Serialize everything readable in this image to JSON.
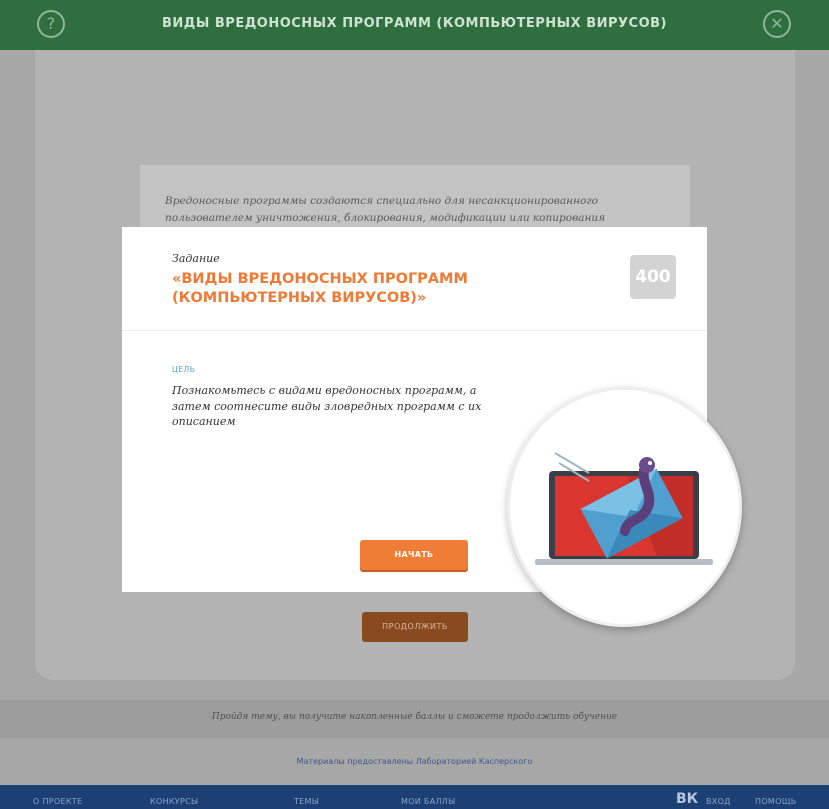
{
  "header": {
    "title": "ВИДЫ ВРЕДОНОСНЫХ ПРОГРАММ (КОМПЬЮТЕРНЫХ ВИРУСОВ)",
    "help_icon": "question-circle-icon",
    "close_icon": "close-circle-icon",
    "help_glyph": "?",
    "close_glyph": "✕"
  },
  "background": {
    "text": "Вредоносные программы создаются специально для несанкционированного пользователем уничтожения, блокирования, модификации или копирования",
    "continue_button": "ПРОДОЛЖИТЬ",
    "info_text": "Пройдя тему, вы получите накопленные баллы и сможете продолжить обучение",
    "link_text": "Материалы предоставлены Лабораторией Касперского"
  },
  "modal": {
    "label": "Задание",
    "title": "«ВИДЫ ВРЕДОНОСНЫХ ПРОГРАММ (КОМПЬЮТЕРНЫХ ВИРУСОВ)»",
    "score": "400",
    "goal_label": "ЦЕЛЬ",
    "goal_text": "Познакомьтесь с видами вредоносных программ, а затем соотнесите виды зловредных программ с их описанием",
    "start_button": "НАЧАТЬ"
  },
  "footer": {
    "items": [
      "О ПРОЕКТЕ",
      "КОНКУРСЫ",
      "ТЕМЫ",
      "МОИ БАЛЛЫ"
    ],
    "vk_icon": "vk-icon",
    "vk_glyph": "ВК",
    "right_items": [
      "ВХОД",
      "ПОМОЩЬ"
    ]
  },
  "colors": {
    "header": "#2f6e3f",
    "accent_orange": "#ef7d36",
    "footer": "#1c3f74",
    "goal_blue": "#4aa3df",
    "laptop_red": "#d9362f"
  }
}
